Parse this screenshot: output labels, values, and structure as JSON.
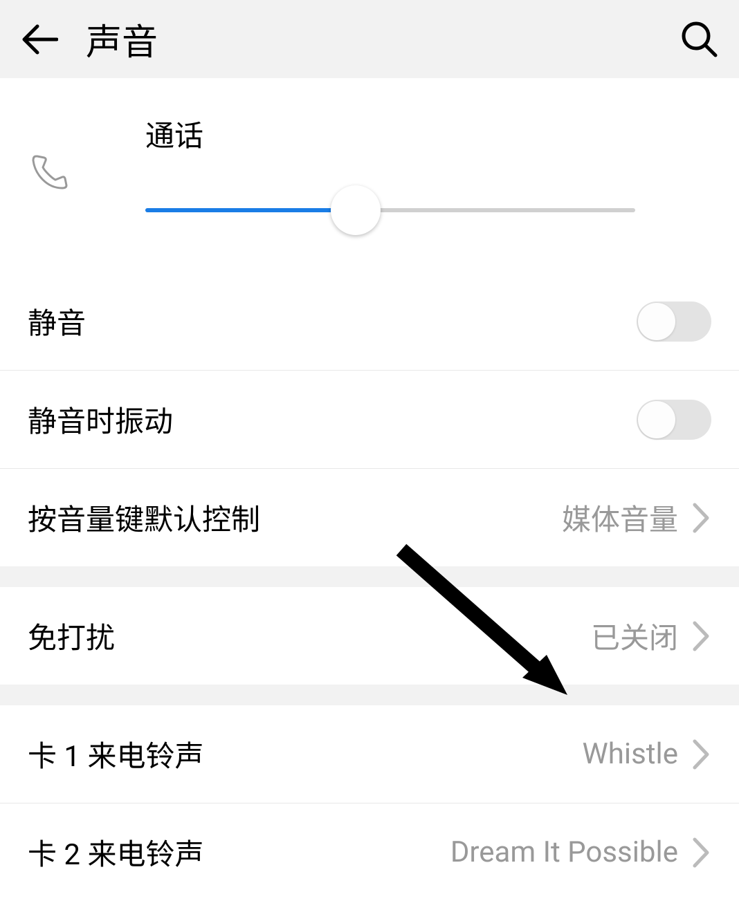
{
  "header": {
    "title": "声音"
  },
  "slider": {
    "label": "通话",
    "value_percent": 43
  },
  "rows": {
    "mute": {
      "label": "静音",
      "on": false
    },
    "vibrate_on_mute": {
      "label": "静音时振动",
      "on": false
    },
    "volume_default": {
      "label": "按音量键默认控制",
      "value": "媒体音量"
    },
    "dnd": {
      "label": "免打扰",
      "value": "已关闭"
    },
    "sim1_ringtone": {
      "label": "卡 1 来电铃声",
      "value": "Whistle"
    },
    "sim2_ringtone": {
      "label": "卡 2 来电铃声",
      "value": "Dream It Possible"
    }
  }
}
